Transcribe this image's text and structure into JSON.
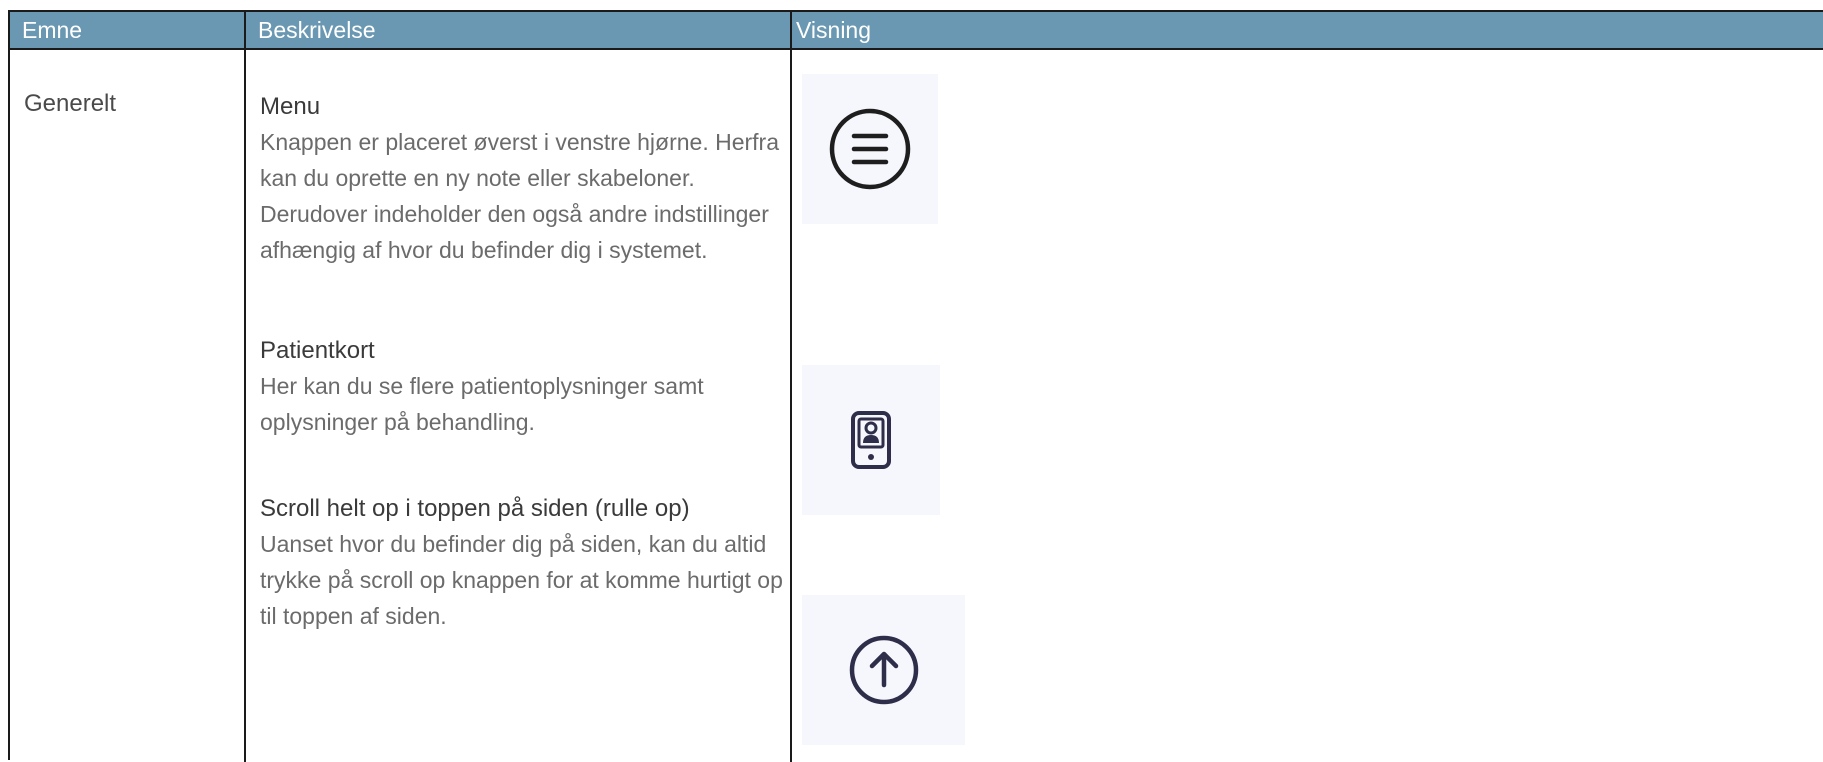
{
  "header": {
    "col1": "Emne",
    "col2": "Beskrivelse",
    "col3": "Visning"
  },
  "topic": "Generelt",
  "entries": [
    {
      "title": "Menu",
      "text": "Knappen er placeret øverst i venstre hjørne. Herfra kan du oprette en ny note eller skabeloner. Derudover indeholder den også andre indstillinger afhængig af hvor du befinder dig i systemet.",
      "icon": "menu-icon"
    },
    {
      "title": "Patientkort",
      "text": "Her kan du se flere patientoplysninger samt oplysninger på behandling.",
      "icon": "patient-card-icon"
    },
    {
      "title": "Scroll helt op i toppen på siden (rulle op)",
      "text": "Uanset hvor du befinder dig på siden, kan du altid trykke på scroll op knappen for at komme hurtigt op til toppen af siden.",
      "icon": "scroll-up-icon"
    }
  ],
  "colors": {
    "header_bg": "#6a98b2",
    "header_text": "#ffffff",
    "icon_stroke": "#2e2e4a",
    "icon_bg": "#f6f7fc",
    "border": "#1a1a1a"
  }
}
